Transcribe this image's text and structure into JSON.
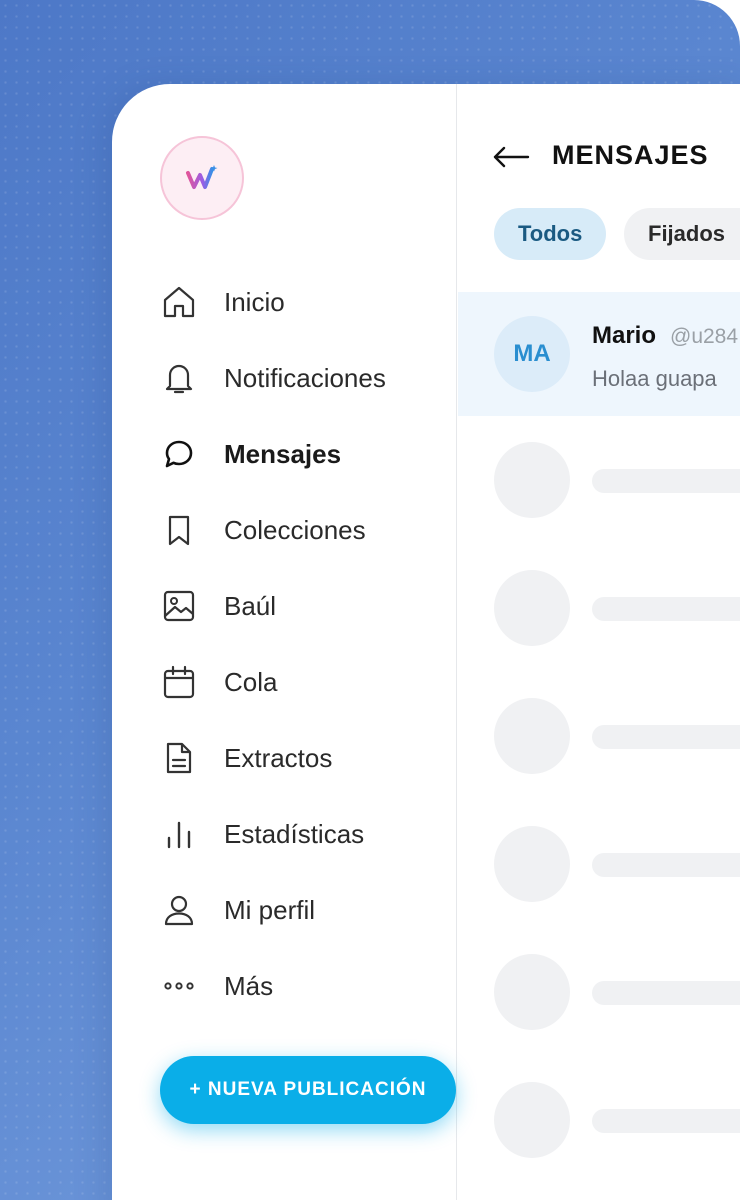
{
  "header": {
    "title": "MENSAJES"
  },
  "filters": [
    {
      "label": "Todos",
      "active": true
    },
    {
      "label": "Fijados",
      "active": false
    }
  ],
  "sidebar": {
    "logo": "brand-logo",
    "items": [
      {
        "label": "Inicio",
        "icon": "home-icon",
        "active": false
      },
      {
        "label": "Notificaciones",
        "icon": "bell-icon",
        "active": false
      },
      {
        "label": "Mensajes",
        "icon": "chat-bubble-icon",
        "active": true
      },
      {
        "label": "Colecciones",
        "icon": "bookmark-icon",
        "active": false
      },
      {
        "label": "Baúl",
        "icon": "image-icon",
        "active": false
      },
      {
        "label": "Cola",
        "icon": "calendar-icon",
        "active": false
      },
      {
        "label": "Extractos",
        "icon": "document-icon",
        "active": false
      },
      {
        "label": "Estadísticas",
        "icon": "bar-chart-icon",
        "active": false
      },
      {
        "label": "Mi perfil",
        "icon": "user-icon",
        "active": false
      },
      {
        "label": "Más",
        "icon": "more-dots-icon",
        "active": false
      }
    ],
    "new_post_label": "+ NUEVA PUBLICACIÓN"
  },
  "messages": [
    {
      "initials": "MA",
      "name": "Mario",
      "handle": "@u284",
      "preview": "Holaa guapa"
    }
  ],
  "colors": {
    "accent": "#0aaee8",
    "active_chip_bg": "#d7ebf8",
    "selected_row_bg": "#eef6fd",
    "skeleton": "#f0f1f3"
  }
}
